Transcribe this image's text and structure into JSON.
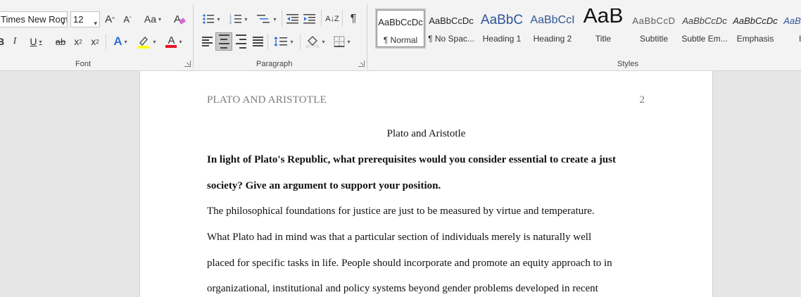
{
  "ribbon": {
    "font": {
      "font_name": "Times New Roman",
      "font_size": "12",
      "grow_label": "A",
      "shrink_label": "A",
      "change_case_label": "Aa",
      "bold_label": "B",
      "italic_label": "I",
      "underline_label": "U",
      "strike_label": "ab",
      "subscript_label": "x",
      "subscript_mark": "2",
      "superscript_label": "x",
      "superscript_mark": "2",
      "text_effects_label": "A",
      "font_color_label": "A",
      "highlight_color": "#ffff00",
      "font_color": "#e81123",
      "group_label": "Font"
    },
    "paragraph": {
      "pilcrow": "¶",
      "sort_label": "A↓Z",
      "group_label": "Paragraph"
    },
    "styles": {
      "group_label": "Styles",
      "items": [
        {
          "preview": "AaBbCcDc",
          "name": "¶ Normal",
          "selected": true
        },
        {
          "preview": "AaBbCcDc",
          "name": "¶ No Spac..."
        },
        {
          "preview": "AaBbC",
          "name": "Heading 1"
        },
        {
          "preview": "AaBbCcI",
          "name": "Heading 2"
        },
        {
          "preview": "AaB",
          "name": "Title"
        },
        {
          "preview": "AaBbCcD",
          "name": "Subtitle"
        },
        {
          "preview": "AaBbCcDc",
          "name": "Subtle Em..."
        },
        {
          "preview": "AaBbCcDc",
          "name": "Emphasis"
        },
        {
          "preview": "AaBbCcDc",
          "name": "Inte"
        }
      ]
    }
  },
  "document": {
    "running_head": "PLATO AND ARISTOTLE",
    "page_number": "2",
    "title": "Plato and Aristotle",
    "question_lines": [
      "In light of Plato's Republic, what prerequisites would you consider essential to create a just",
      "society? Give an argument to support your position."
    ],
    "body_lines": [
      "The philosophical foundations for justice are just to be measured by virtue and temperature.",
      "What Plato had in mind was that a particular section of individuals merely is naturally well",
      "placed for specific tasks in life. People should incorporate and promote an equity approach to in",
      "organizational, institutional and policy systems beyond gender problems developed in recent"
    ]
  }
}
